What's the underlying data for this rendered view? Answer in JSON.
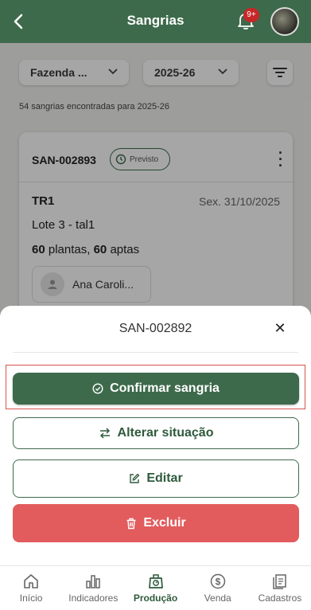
{
  "header": {
    "title": "Sangrias",
    "badge": "9+"
  },
  "filters": {
    "farm": "Fazenda ...",
    "year": "2025-26"
  },
  "count_text": "54 sangrias encontradas para 2025-26",
  "card": {
    "code": "SAN-002893",
    "status": "Previsto",
    "tree": "TR1",
    "date": "Sex. 31/10/2025",
    "lote": "Lote 3 - tal1",
    "plants_count": "60",
    "plants_label": "plantas,",
    "apt_count": "60",
    "apt_label": "aptas",
    "person": "Ana Caroli..."
  },
  "sheet": {
    "title": "SAN-002892",
    "confirm_label": "Confirmar sangria",
    "alter_label": "Alterar situação",
    "edit_label": "Editar",
    "delete_label": "Excluir"
  },
  "tabs": [
    {
      "label": "Início",
      "icon": "home-icon"
    },
    {
      "label": "Indicadores",
      "icon": "bar-chart-icon"
    },
    {
      "label": "Produção",
      "icon": "scale-icon"
    },
    {
      "label": "Venda",
      "icon": "dollar-icon"
    },
    {
      "label": "Cadastros",
      "icon": "documents-icon"
    }
  ],
  "colors": {
    "primary": "#3d6a4b",
    "danger": "#e25c5e",
    "highlight": "#d9534f",
    "badge": "#c62828"
  }
}
